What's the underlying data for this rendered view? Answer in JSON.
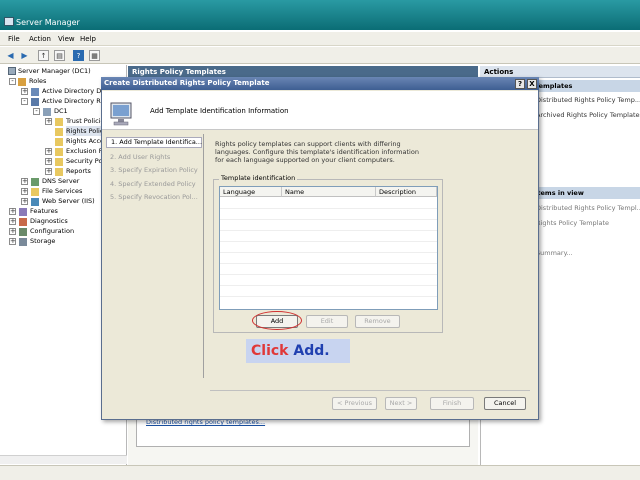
{
  "window": {
    "title": "Server Manager"
  },
  "menu": [
    "File",
    "Action",
    "View",
    "Help"
  ],
  "tree": {
    "root": "Server Manager (DC1)",
    "roles": "Roles",
    "ad_ds": "Active Directory Do",
    "ad_rms": "Active Directory Rig",
    "dc1": "DC1",
    "trust_policies": "Trust Policie",
    "rights_policy": "Rights Polic",
    "rights_account": "Rights Acco",
    "exclusion": "Exclusion P",
    "security": "Security Pol",
    "reports": "Reports",
    "dns": "DNS Server",
    "file_services": "File Services",
    "web_server": "Web Server (IIS)",
    "features": "Features",
    "diagnostics": "Diagnostics",
    "configuration": "Configuration",
    "storage": "Storage"
  },
  "center": {
    "header": "Rights Policy Templates",
    "link": "Distributed rights policy templates..."
  },
  "actions": {
    "header": "Actions",
    "section1": "Templates",
    "item1": "Distributed Rights Policy Temp...",
    "item2": "Archived Rights Policy Templates",
    "section2": "Items in view",
    "item3": "Distributed Rights Policy Templ...",
    "item4": "Rights Policy Template",
    "item5": "Summary..."
  },
  "dialog": {
    "title": "Create Distributed Rights Policy Template",
    "help_btn": "?",
    "close_btn": "X",
    "header": "Add Template Identification Information",
    "steps": [
      "1. Add Template Identifica...",
      "2. Add User Rights",
      "3. Specify Expiration Policy",
      "4. Specify Extended Policy",
      "5. Specify Revocation Pol..."
    ],
    "description": "Rights policy templates can support clients with differing languages. Configure this template's identification information for each language supported on your client computers.",
    "group_label": "Template identification",
    "columns": [
      "Language",
      "Name",
      "Description"
    ],
    "buttons": {
      "add": "Add",
      "edit": "Edit",
      "remove": "Remove"
    },
    "nav": {
      "previous": "< Previous",
      "next": "Next >",
      "finish": "Finish",
      "cancel": "Cancel"
    }
  },
  "callout": {
    "action": "Click",
    "target": "Add."
  },
  "colors": {
    "titlebar": "#0b6d75",
    "dialog_title": "#3e5e92",
    "callout_bg": "#c8d4f0",
    "callout_red": "#e03838",
    "callout_blue": "#2040b0"
  }
}
